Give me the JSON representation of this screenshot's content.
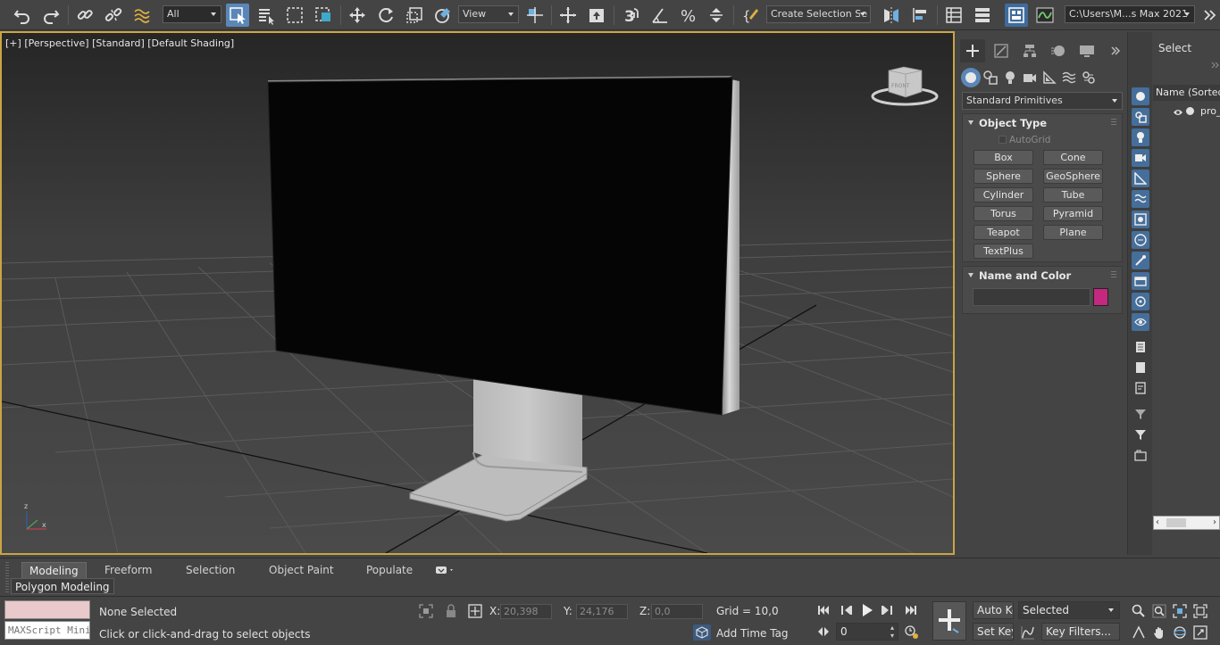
{
  "toolbar": {
    "selection_filter": "All",
    "ref_coord": "View",
    "named_selection_placeholder": "Create Selection Se",
    "project_path": "C:\\Users\\M...s Max 2021"
  },
  "viewport": {
    "label_plus": "[+]",
    "label_view": "[Perspective]",
    "label_mode": "[Standard]",
    "label_shading": "[Default Shading]",
    "viewcube_text": "FRONT",
    "axis_z": "z",
    "axis_x": "x"
  },
  "command_panel": {
    "primitive_type": "Standard Primitives",
    "object_type_title": "Object Type",
    "autogrid_label": "AutoGrid",
    "buttons": [
      "Box",
      "Cone",
      "Sphere",
      "GeoSphere",
      "Cylinder",
      "Tube",
      "Torus",
      "Pyramid",
      "Teapot",
      "Plane",
      "TextPlus"
    ],
    "name_color_title": "Name and Color",
    "object_color": "#c4297f"
  },
  "explorer": {
    "header": "Select",
    "column_header": "Name (Sorted Ascending)",
    "row_name": "pro_"
  },
  "ribbon": {
    "tabs": [
      "Modeling",
      "Freeform",
      "Selection",
      "Object Paint",
      "Populate"
    ],
    "sub_tab": "Polygon Modeling"
  },
  "status": {
    "maxscript_placeholder": "MAXScript Mini Listener",
    "selection": "None Selected",
    "prompt": "Click or click-and-drag to select objects",
    "x_label": "X:",
    "x_value": "20,398",
    "y_label": "Y:",
    "y_value": "24,176",
    "z_label": "Z:",
    "z_value": "0,0",
    "grid": "Grid = 10,0",
    "add_time_tag": "Add Time Tag",
    "auto_key": "Auto Key",
    "set_key": "Set Key",
    "key_mode": "Selected",
    "key_filters": "Key Filters...",
    "frame": "0"
  },
  "colors": {
    "viewport_border": "#c9a544",
    "accent": "#5b87b8",
    "object_color": "#c4297f"
  }
}
